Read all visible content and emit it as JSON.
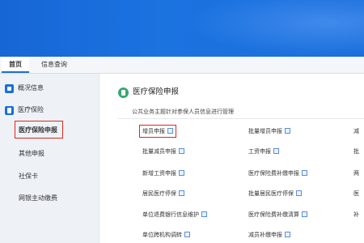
{
  "nav": {
    "tabs": [
      {
        "label": "首页"
      },
      {
        "label": "信息查询"
      }
    ]
  },
  "sidebar": {
    "items": [
      {
        "label": "概况信息",
        "icon": "home-icon"
      },
      {
        "label": "医疗保险",
        "icon": "document-icon"
      },
      {
        "label": "医疗保险申报"
      },
      {
        "label": "其他申报"
      },
      {
        "label": "社保卡"
      },
      {
        "label": "网银主动缴费"
      }
    ]
  },
  "main": {
    "title": "医疗保险申报",
    "description": "公共业务主题针对参保人员信息进行管理",
    "items": [
      {
        "label": "增员申报"
      },
      {
        "label": "批量增员申报"
      },
      {
        "label": "减"
      },
      {
        "label": "批量减员申报"
      },
      {
        "label": "工资申报"
      },
      {
        "label": "批"
      },
      {
        "label": "新增工资申报"
      },
      {
        "label": "医疗保险费补缴申报"
      },
      {
        "label": "两"
      },
      {
        "label": "居民医疗停保"
      },
      {
        "label": "批量居民医疗停保"
      },
      {
        "label": "医"
      },
      {
        "label": "单位退费银行信息维护"
      },
      {
        "label": "医疗保险费补缴清算"
      },
      {
        "label": "补"
      },
      {
        "label": "单位跨机构调转"
      },
      {
        "label": "减员补缴申报"
      }
    ]
  },
  "colors": {
    "banner": "#1a6edb",
    "highlight": "#e0251b",
    "title_icon": "#3aa76d"
  }
}
